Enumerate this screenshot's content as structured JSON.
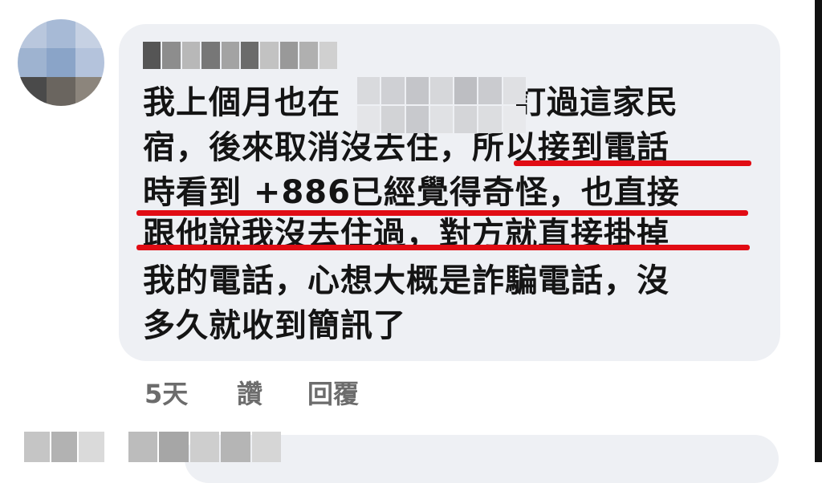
{
  "comment": {
    "lines": [
      "我上個月也在",
      "訂過這家民",
      "宿，後來取消沒去住，所以接到電話",
      "時看到 +886已經覺得奇怪，也直接",
      "跟他說我沒去住過，對方就直接掛掉",
      "我的電話，心想大概是詐騙電話，沒",
      "多久就收到簡訊了"
    ]
  },
  "actions": {
    "time": "5天",
    "like": "讚",
    "reply": "回覆"
  },
  "colors": {
    "bubble": "#eef0f4",
    "underline": "#e10c14",
    "meta_text": "#6c6c6c"
  }
}
